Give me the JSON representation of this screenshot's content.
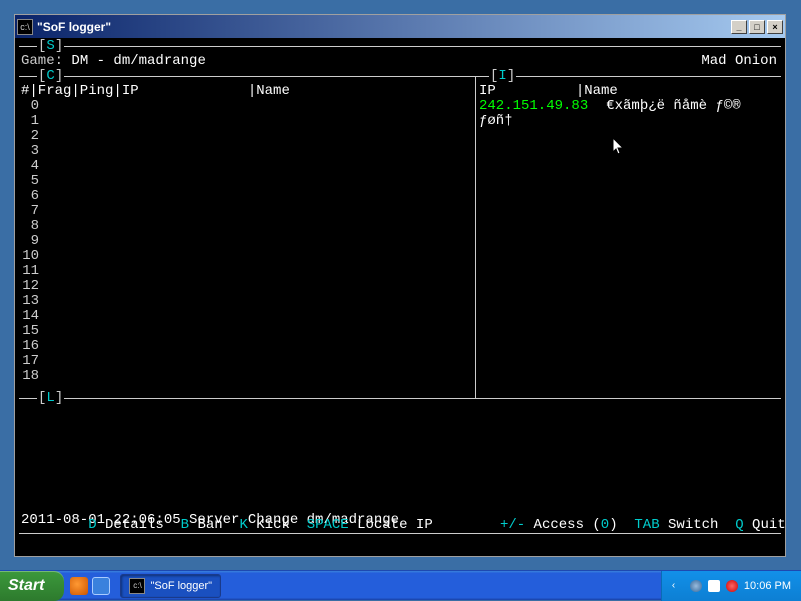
{
  "window": {
    "title": "\"SoF logger\""
  },
  "header": {
    "label_S": "S",
    "game_prefix": "Game: ",
    "game_text": "DM - dm/madrange",
    "server_name": "Mad Onion"
  },
  "panel_c": {
    "label": "C",
    "header": "#|Frag|Ping|IP             |Name",
    "row_count": 19
  },
  "panel_i": {
    "label": "I",
    "header_ip": "IP",
    "header_name": "|Name",
    "entry_ip": "242.151.49.83",
    "entry_name": "€xãmþ¿ë ñåmè ƒ©® ƒøñ†"
  },
  "panel_l": {
    "label": "L",
    "log_line": "2011-08-01 22:06:05 Server Change     dm/madrange"
  },
  "hints": {
    "d_key": "D",
    "d_label": " Details  ",
    "b_key": "B",
    "b_label": " Ban  ",
    "k_key": "K",
    "k_label": " Kick  ",
    "space_key": "SPACE",
    "space_label": " Locate IP",
    "access_key": "+/-",
    "access_label": " Access (",
    "access_count": "0",
    "access_close": ")  ",
    "tab_key": "TAB",
    "tab_label": " Switch  ",
    "q_key": "Q",
    "q_label": " Quit"
  },
  "taskbar": {
    "start": "Start",
    "task_label": "\"SoF logger\"",
    "clock": "10:06 PM"
  }
}
